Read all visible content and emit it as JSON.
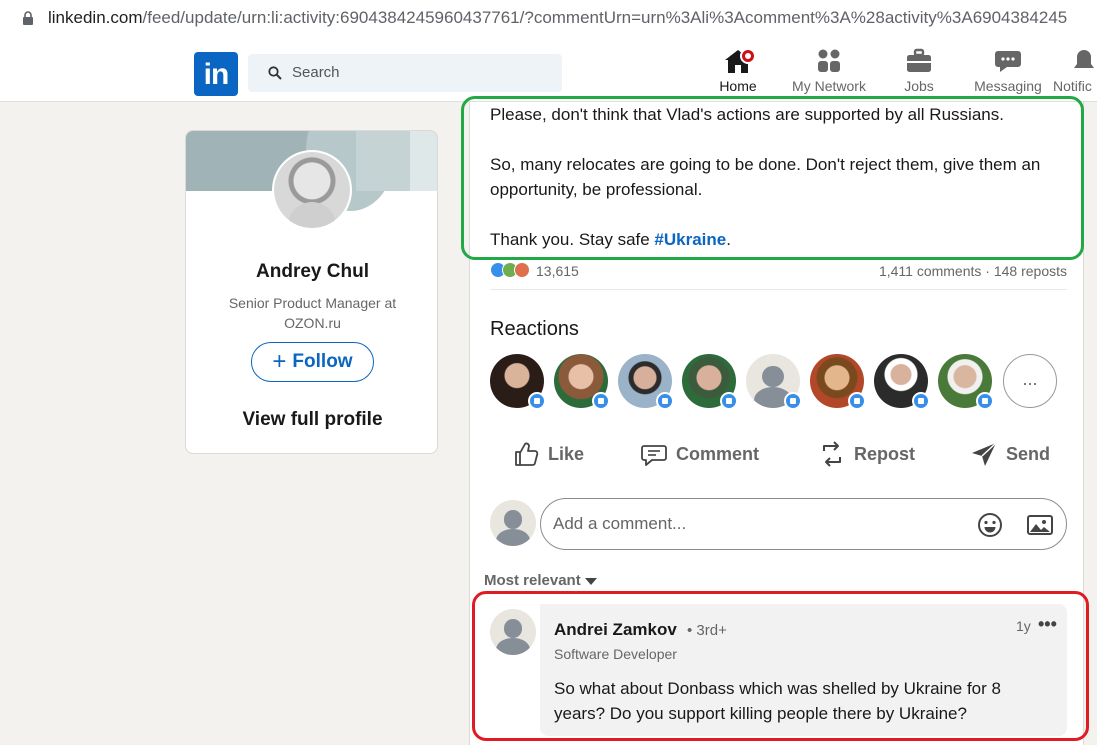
{
  "browser": {
    "url_host": "linkedin.com",
    "url_path": "/feed/update/urn:li:activity:6904384245960437761/?commentUrn=urn%3Ali%3Acomment%3A%28activity%3A6904384245"
  },
  "nav": {
    "logo": "in",
    "search_placeholder": "Search",
    "items": [
      {
        "label": "Home"
      },
      {
        "label": "My Network"
      },
      {
        "label": "Jobs"
      },
      {
        "label": "Messaging"
      },
      {
        "label": "Notific"
      }
    ]
  },
  "profile": {
    "name": "Andrey Chul",
    "headline": "Senior Product Manager at OZON.ru",
    "follow_label": "Follow",
    "view_profile": "View full profile"
  },
  "post": {
    "paragraphs": [
      "Please, don't think that Vlad's actions are supported by all Russians.",
      "So, many relocates are going to be done. Don't reject them, give them an opportunity, be professional."
    ],
    "closing_text": "Thank you. Stay safe ",
    "hashtag": "#Ukraine",
    "closing_end": ".",
    "reaction_count": "13,615",
    "comments_reposts": "1,411 comments · 148 reposts",
    "reactions_title": "Reactions",
    "more_label": "...",
    "actions": {
      "like": "Like",
      "comment": "Comment",
      "repost": "Repost",
      "send": "Send"
    },
    "comment_placeholder": "Add a comment...",
    "sort_label": "Most relevant"
  },
  "comment": {
    "author": "Andrei Zamkov",
    "degree": "• 3rd+",
    "time": "1y",
    "more": "•••",
    "title": "Software Developer",
    "text": "So what about Donbass which was shelled by Ukraine for 8 years? Do you support killing people there by Ukraine?"
  },
  "colors": {
    "accent": "#0a66c2",
    "highlight_green": "#22a845",
    "highlight_red": "#e01b24"
  }
}
